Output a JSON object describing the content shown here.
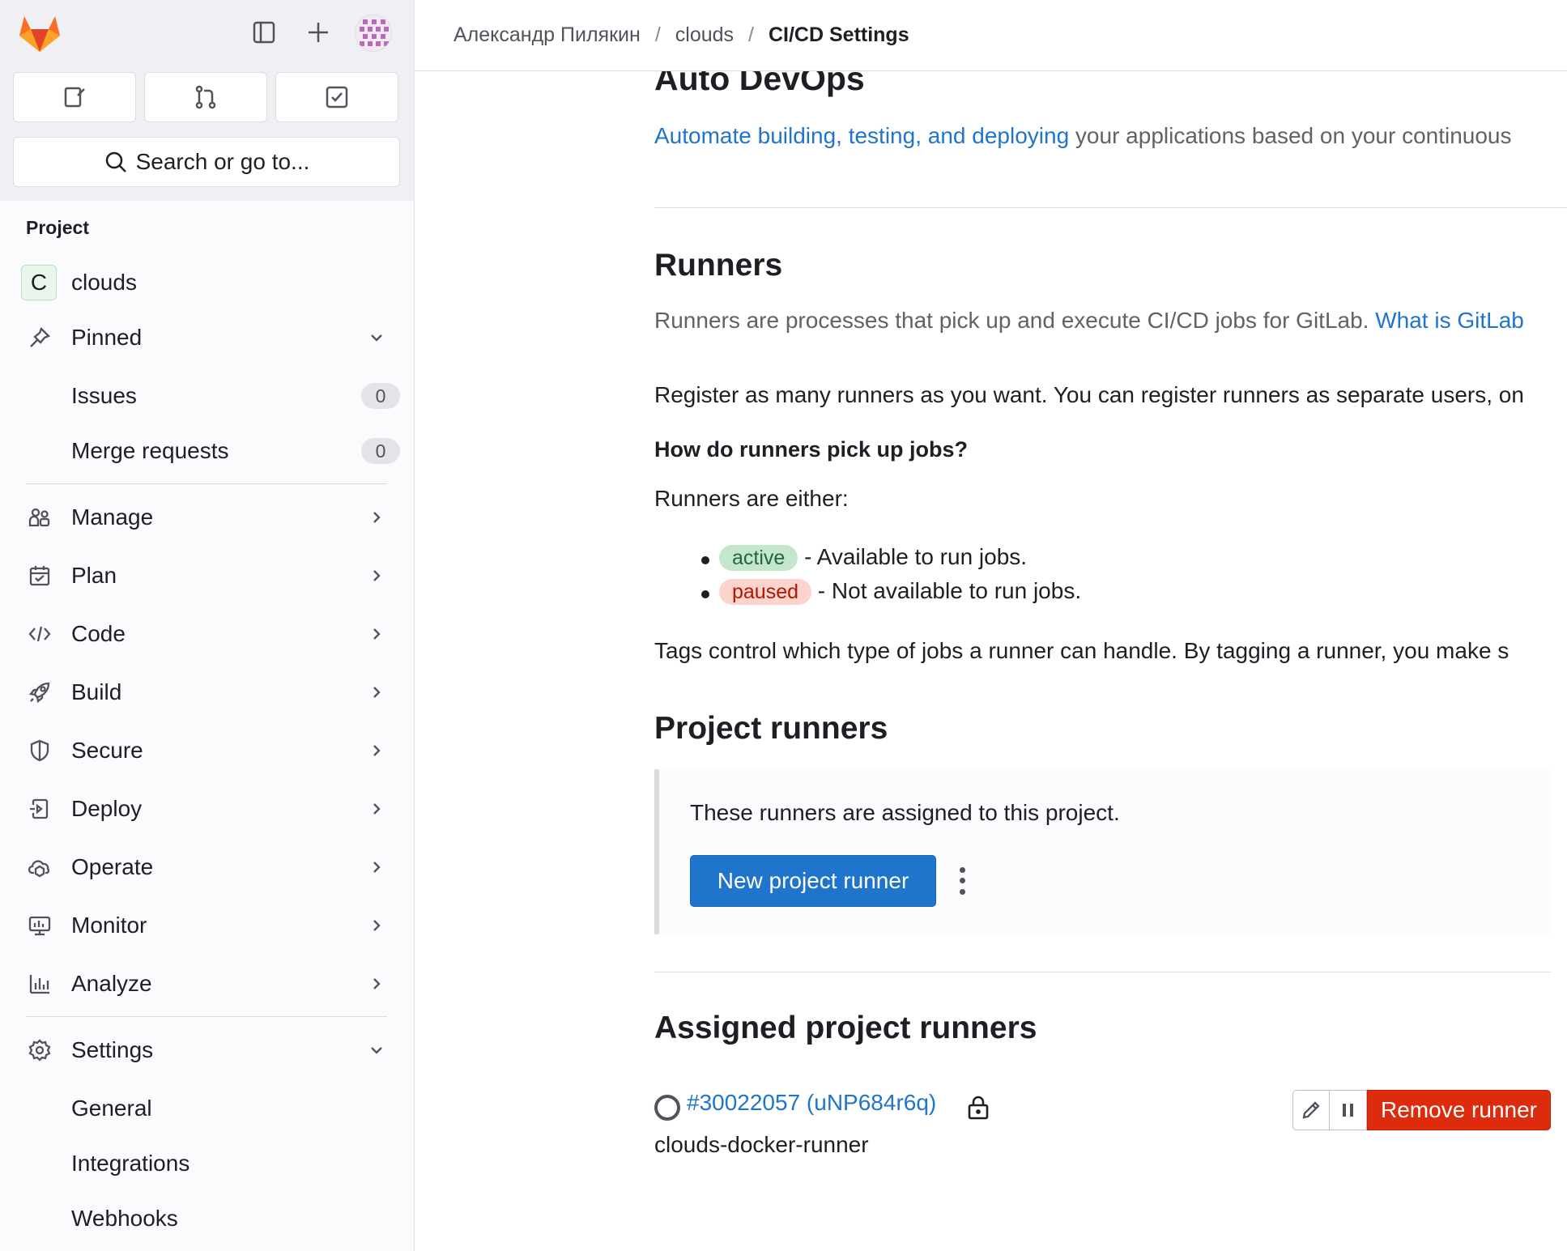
{
  "sidebar": {
    "search_placeholder": "Search or go to...",
    "section_label": "Project",
    "project": {
      "initial": "C",
      "name": "clouds"
    },
    "pinned": {
      "label": "Pinned",
      "items": [
        {
          "label": "Issues",
          "count": "0"
        },
        {
          "label": "Merge requests",
          "count": "0"
        }
      ]
    },
    "nav": [
      {
        "label": "Manage",
        "icon": "users-icon"
      },
      {
        "label": "Plan",
        "icon": "calendar-icon"
      },
      {
        "label": "Code",
        "icon": "code-icon"
      },
      {
        "label": "Build",
        "icon": "rocket-icon"
      },
      {
        "label": "Secure",
        "icon": "shield-icon"
      },
      {
        "label": "Deploy",
        "icon": "deploy-icon"
      },
      {
        "label": "Operate",
        "icon": "cloud-icon"
      },
      {
        "label": "Monitor",
        "icon": "monitor-icon"
      },
      {
        "label": "Analyze",
        "icon": "chart-icon"
      }
    ],
    "settings": {
      "label": "Settings",
      "items": [
        {
          "label": "General"
        },
        {
          "label": "Integrations"
        },
        {
          "label": "Webhooks"
        }
      ]
    }
  },
  "breadcrumb": {
    "items": [
      "Александр Пилякин",
      "clouds",
      "CI/CD Settings"
    ]
  },
  "main": {
    "auto_devops": {
      "title": "Auto DevOps",
      "link": "Automate building, testing, and deploying",
      "text": " your applications based on your continuous"
    },
    "runners": {
      "title": "Runners",
      "desc": "Runners are processes that pick up and execute CI/CD jobs for GitLab. ",
      "desc_link": "What is GitLab",
      "register": "Register as many runners as you want. You can register runners as separate users, on",
      "question": "How do runners pick up jobs?",
      "either": "Runners are either:",
      "states": [
        {
          "badge": "active",
          "text": " - Available to run jobs."
        },
        {
          "badge": "paused",
          "text": " - Not available to run jobs."
        }
      ],
      "tags": "Tags control which type of jobs a runner can handle. By tagging a runner, you make s"
    },
    "project_runners": {
      "title": "Project runners",
      "callout": "These runners are assigned to this project.",
      "new_button": "New project runner"
    },
    "assigned": {
      "title": "Assigned project runners",
      "runner_id": "#30022057 (uNP684r6q)",
      "runner_name": "clouds-docker-runner",
      "remove_button": "Remove runner"
    }
  },
  "colors": {
    "brand": "#fc6d26",
    "link": "#1f75cb",
    "danger": "#dd2b0e"
  }
}
